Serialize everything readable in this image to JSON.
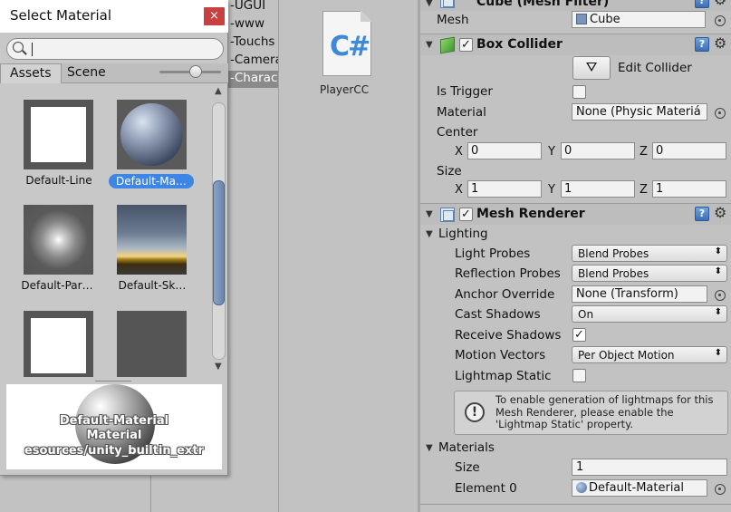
{
  "hierarchy": {
    "items": [
      "-UGUI",
      "-www",
      "-Touchs",
      "-Camera",
      "-Charac"
    ]
  },
  "project": {
    "file_name": "PlayerCC",
    "file_glyph": "C#"
  },
  "inspector": {
    "mesh_filter": {
      "title": "Cube (Mesh Filter)",
      "mesh_label": "Mesh",
      "mesh_value": "Cube"
    },
    "box_collider": {
      "title": "Box Collider",
      "edit_collider_label": "Edit Collider",
      "is_trigger_label": "Is Trigger",
      "material_label": "Material",
      "material_value": "None (Physic Materiá",
      "center_label": "Center",
      "center": {
        "x": "0",
        "y": "0",
        "z": "0"
      },
      "size_label": "Size",
      "size": {
        "x": "1",
        "y": "1",
        "z": "1"
      },
      "axis_labels": {
        "x": "X",
        "y": "Y",
        "z": "Z"
      }
    },
    "mesh_renderer": {
      "title": "Mesh Renderer",
      "lighting_label": "Lighting",
      "light_probes_label": "Light Probes",
      "light_probes_value": "Blend Probes",
      "reflection_probes_label": "Reflection Probes",
      "reflection_probes_value": "Blend Probes",
      "anchor_override_label": "Anchor Override",
      "anchor_override_value": "None (Transform)",
      "cast_shadows_label": "Cast Shadows",
      "cast_shadows_value": "On",
      "receive_shadows_label": "Receive Shadows",
      "receive_shadows_checked": true,
      "motion_vectors_label": "Motion Vectors",
      "motion_vectors_value": "Per Object Motion",
      "lightmap_static_label": "Lightmap Static",
      "lightmap_static_checked": false,
      "info_text": "To enable generation of lightmaps for this Mesh Renderer, please enable the 'Lightmap Static' property.",
      "materials_label": "Materials",
      "size_label": "Size",
      "size_value": "1",
      "element0_label": "Element 0",
      "element0_value": "Default-Material"
    }
  },
  "select_material": {
    "title": "Select Material",
    "close_glyph": "×",
    "search_value": "",
    "tabs": [
      "Assets",
      "Scene"
    ],
    "active_tab": "Assets",
    "items": [
      {
        "name": "Default-Line",
        "selected": false
      },
      {
        "name": "Default-Ma…",
        "selected": true
      },
      {
        "name": "Default-Par…",
        "selected": false
      },
      {
        "name": "Default-Sk…",
        "selected": false
      },
      {
        "name": "",
        "selected": false
      },
      {
        "name": "",
        "selected": false
      }
    ],
    "preview": {
      "line1": "Default-Material",
      "line2": "Material",
      "line3": "esources/unity_builtin_extr"
    }
  },
  "colors": {
    "selection": "#3d86e6",
    "close_button": "#c94040"
  }
}
